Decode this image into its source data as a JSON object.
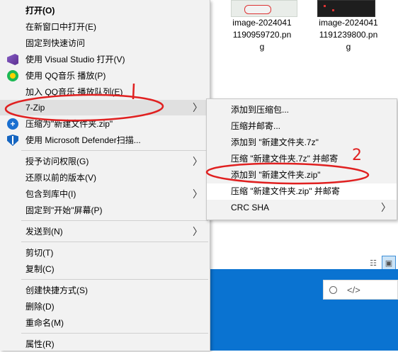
{
  "files": [
    {
      "name_line1": "image-2024041",
      "name_line2": "1190959720.pn",
      "name_line3": "g"
    },
    {
      "name_line1": "image-2024041",
      "name_line2": "1191239800.pn",
      "name_line3": "g"
    }
  ],
  "context_menu": {
    "items": [
      {
        "label": "打开(O)"
      },
      {
        "label": "在新窗口中打开(E)"
      },
      {
        "label": "固定到快速访问"
      },
      {
        "label": "使用 Visual Studio 打开(V)",
        "icon": "visual-studio-icon"
      },
      {
        "label": "使用 QQ音乐 播放(P)",
        "icon": "qq-music-icon"
      },
      {
        "label": "加入 QQ音乐 播放队列(E)"
      },
      {
        "label": "7-Zip",
        "has_submenu": true
      },
      {
        "label": "压缩为\"新建文件夹.zip\"",
        "icon": "zip-icon"
      },
      {
        "label": "使用 Microsoft Defender扫描...",
        "icon": "defender-shield-icon"
      },
      {
        "label": "授予访问权限(G)",
        "has_submenu": true
      },
      {
        "label": "还原以前的版本(V)"
      },
      {
        "label": "包含到库中(I)",
        "has_submenu": true
      },
      {
        "label": "固定到\"开始\"屏幕(P)"
      },
      {
        "label": "发送到(N)",
        "has_submenu": true
      },
      {
        "label": "剪切(T)"
      },
      {
        "label": "复制(C)"
      },
      {
        "label": "创建快捷方式(S)"
      },
      {
        "label": "删除(D)"
      },
      {
        "label": "重命名(M)"
      },
      {
        "label": "属性(R)"
      }
    ]
  },
  "submenu_7zip": {
    "items": [
      {
        "label": "添加到压缩包..."
      },
      {
        "label": "压缩并邮寄..."
      },
      {
        "label": "添加到 \"新建文件夹.7z\""
      },
      {
        "label": "压缩 \"新建文件夹.7z\" 并邮寄"
      },
      {
        "label": "添加到 \"新建文件夹.zip\""
      },
      {
        "label": "压缩 \"新建文件夹.zip\" 并邮寄"
      },
      {
        "label": "CRC SHA",
        "has_submenu": true
      }
    ]
  },
  "annotations": {
    "step1": "1",
    "step2": "2",
    "color": "#e02020"
  },
  "colors": {
    "menu_bg": "#f2f2f2",
    "highlight": "#e0e0e0",
    "desktop_blue": "#0a73d1"
  }
}
